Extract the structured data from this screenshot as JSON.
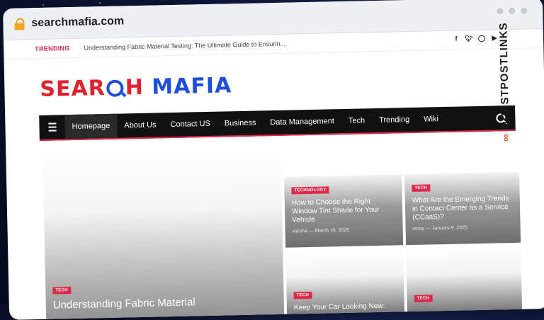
{
  "browser": {
    "url": "searchmafia.com"
  },
  "trending": {
    "label": "TRENDING",
    "headline": "Understanding Fabric Material Testing: The Ultimate Guide to Ensurin..."
  },
  "social_icons": [
    "facebook-icon",
    "twitter-icon",
    "instagram-icon",
    "youtube-icon"
  ],
  "logo": {
    "part1": "SEAR",
    "part2": "H",
    "part3": "MAFIA"
  },
  "nav": {
    "items": [
      {
        "label": "Homepage",
        "active": true
      },
      {
        "label": "About Us"
      },
      {
        "label": "Contact US"
      },
      {
        "label": "Business"
      },
      {
        "label": "Data Management"
      },
      {
        "label": "Tech"
      },
      {
        "label": "Trending"
      },
      {
        "label": "Wiki"
      }
    ]
  },
  "brand_watermark": "GUESTPOSTLINKS",
  "posts": {
    "big": {
      "category": "TECH",
      "title": "Understanding Fabric Material"
    },
    "p1": {
      "category": "TECHNOLOGY",
      "title": "How to Choose the Right Window Tint Shade for Your Vehicle",
      "author": "varsha",
      "date": "March 16, 2025"
    },
    "p2": {
      "category": "TECH",
      "title": "What Are the Emerging Trends in Contact Center as a Service (CCaaS)?",
      "author": "vinay",
      "date": "January 9, 2025"
    },
    "p3": {
      "category": "TECH",
      "title": "Keep Your Car Looking New:"
    },
    "p4": {
      "category": "TECH",
      "title": ""
    }
  },
  "colors": {
    "accent": "#e0294a",
    "logo_red": "#e3202d",
    "logo_blue": "#1f4fd8",
    "navbar": "#111111"
  }
}
